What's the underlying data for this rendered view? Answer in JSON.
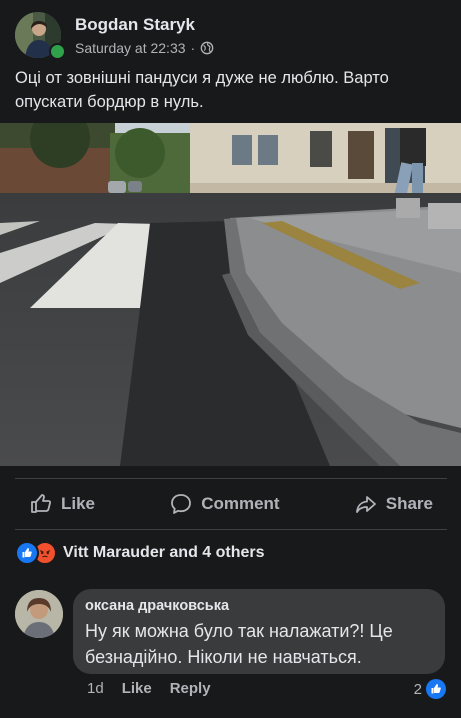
{
  "post": {
    "author": "Bogdan Staryk",
    "timestamp": "Saturday at 22:33",
    "separator": "·",
    "privacy_icon": "globe-icon",
    "text": "Оці от зовнішні пандуси я дуже не люблю. Варто опускати бордюр в нуль."
  },
  "actions": {
    "like": "Like",
    "comment": "Comment",
    "share": "Share"
  },
  "reactions": {
    "types": [
      "like",
      "angry"
    ],
    "summary": "Vitt Marauder and 4 others"
  },
  "comment": {
    "author": "оксана драчковська",
    "text": "Ну як можна було так налажати?! Це безнадійно. Ніколи не навчаться.",
    "age": "1d",
    "like_label": "Like",
    "reply_label": "Reply",
    "reaction_count": "2"
  },
  "colors": {
    "background": "#18191a",
    "bubble": "#3a3b3c",
    "accent": "#1877f2",
    "angry": "#f0502e",
    "online": "#31a24c"
  }
}
